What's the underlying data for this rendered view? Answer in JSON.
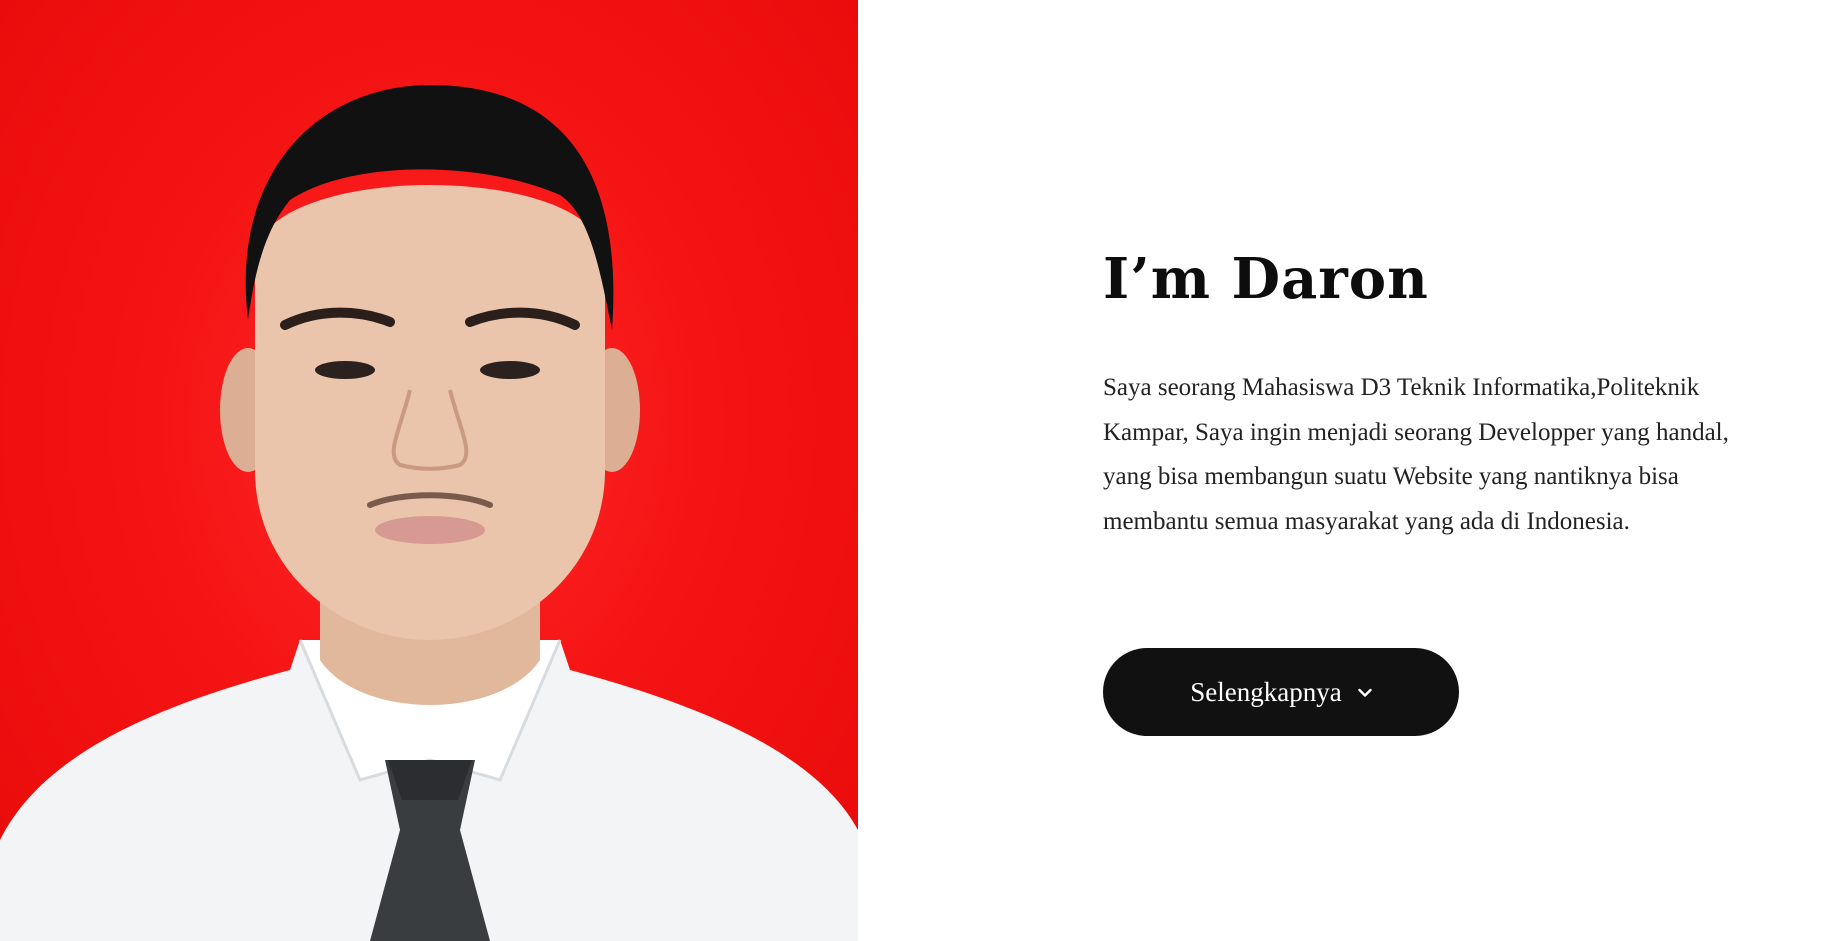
{
  "profile": {
    "photo_icon": "person-portrait",
    "photo_background": "#f51414"
  },
  "hero": {
    "title": "I’m Daron",
    "bio": "Saya seorang Mahasiswa D3 Teknik Informatika,Politeknik Kampar, Saya ingin menjadi seorang Developper yang handal, yang bisa membangun suatu Website yang nantiknya bisa membantu semua masyarakat yang ada di Indonesia.",
    "cta_label": "Selengkapnya",
    "cta_icon": "chevron-down-icon"
  },
  "colors": {
    "button_bg": "#111111",
    "button_text": "#ffffff",
    "title_text": "#0d0d0d"
  }
}
